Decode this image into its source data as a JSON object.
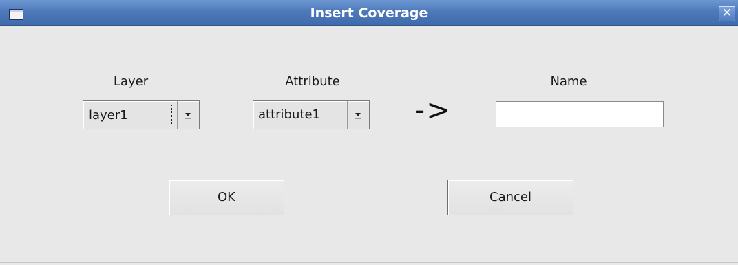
{
  "window": {
    "title": "Insert Coverage",
    "close_glyph": "✕",
    "icons": {
      "window_menu": "window-menu-icon",
      "close": "close-icon"
    }
  },
  "form": {
    "layer": {
      "label": "Layer",
      "selected": "layer1"
    },
    "attribute": {
      "label": "Attribute",
      "selected": "attribute1"
    },
    "mapping_symbol": "->",
    "name": {
      "label": "Name",
      "value": ""
    }
  },
  "buttons": {
    "ok": "OK",
    "cancel": "Cancel"
  },
  "colors": {
    "titlebar": "#4d79b9",
    "background": "#e8e8e8"
  }
}
